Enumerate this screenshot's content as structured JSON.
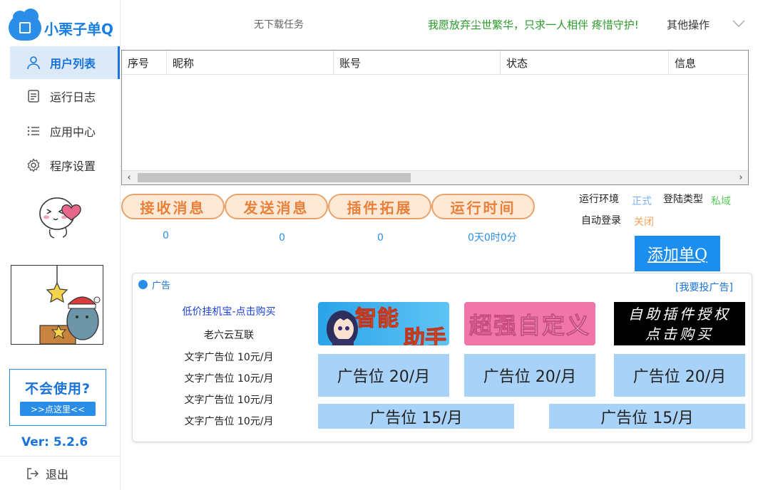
{
  "app": {
    "name": "小栗子单Q",
    "version": "Ver: 5.2.6"
  },
  "sidebar": {
    "items": [
      {
        "label": "用户列表",
        "icon": "user-icon",
        "active": true
      },
      {
        "label": "运行日志",
        "icon": "log-icon",
        "active": false
      },
      {
        "label": "应用中心",
        "icon": "list-icon",
        "active": false
      },
      {
        "label": "程序设置",
        "icon": "gear-icon",
        "active": false
      }
    ],
    "help_title": "不会使用?",
    "help_link": ">>点这里<<",
    "logout": "退出"
  },
  "header": {
    "task_status": "无下载任务",
    "slogan": "我愿放弃尘世繁华，只求一人相伴 疼惜守护!",
    "other_ops": "其他操作"
  },
  "table": {
    "columns": [
      "序号",
      "昵称",
      "账号",
      "状态",
      "信息"
    ],
    "rows": []
  },
  "stats": [
    {
      "label": "接收消息",
      "value": "0"
    },
    {
      "label": "发送消息",
      "value": "0"
    },
    {
      "label": "插件拓展",
      "value": "0"
    },
    {
      "label": "运行时间",
      "value": "0天0时0分"
    }
  ],
  "env": {
    "run_env_label": "运行环境",
    "run_env_value": "正式",
    "login_type_label": "登陆类型",
    "login_type_value": "私域",
    "auto_login_label": "自动登录",
    "auto_login_value": "关闭"
  },
  "add_button": "添加单Q",
  "ads": {
    "title": "广告",
    "apply": "[我要投广告]",
    "text_ads": [
      "低价挂机宝-点击购买",
      "老六云互联",
      "文字广告位 10元/月",
      "文字广告位 10元/月",
      "文字广告位 10元/月",
      "文字广告位 10元/月"
    ],
    "image_ads": [
      "智能助手",
      "超强自定义",
      "自助插件授权点击购买"
    ],
    "slots_20": [
      "广告位 20/月",
      "广告位 20/月",
      "广告位 20/月"
    ],
    "slots_15": [
      "广告位 15/月",
      "广告位 15/月"
    ]
  },
  "colors": {
    "accent": "#1a73d9",
    "slogan": "#2a9a2a",
    "pill_text": "#e8803a",
    "pill_bg": "#fde9d6",
    "env_blue": "#7ab3f0",
    "env_green": "#5cc95c",
    "env_orange": "#f2a35a",
    "ad_slot": "#a9d2f9"
  }
}
